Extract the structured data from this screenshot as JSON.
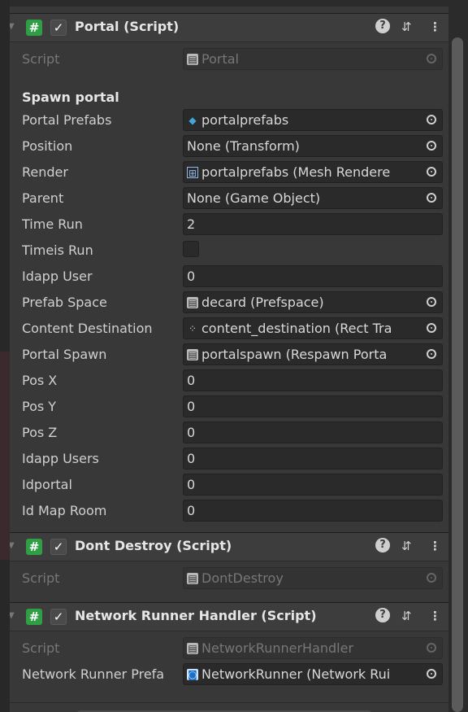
{
  "components": [
    {
      "title": "Portal (Script)",
      "script_label": "Script",
      "script_value": "Portal",
      "section_header": "Spawn portal",
      "fields": [
        {
          "label": "Portal Prefabs",
          "value": "portalprefabs",
          "icon": "prefab-icon",
          "picker": true
        },
        {
          "label": "Position",
          "value": "None (Transform)",
          "icon": "",
          "picker": true
        },
        {
          "label": "Render",
          "value": "portalprefabs (Mesh Rendere",
          "icon": "mesh-renderer-icon",
          "picker": true
        },
        {
          "label": "Parent",
          "value": "None (Game Object)",
          "icon": "",
          "picker": true
        },
        {
          "label": "Time Run",
          "value": "2",
          "icon": "",
          "picker": false
        },
        {
          "label": "Timeis Run",
          "value": "",
          "type": "toggle",
          "checked": false
        },
        {
          "label": "Idapp User",
          "value": "0",
          "icon": "",
          "picker": false
        },
        {
          "label": "Prefab Space",
          "value": "decard (Prefspace)",
          "icon": "script-icon",
          "picker": true
        },
        {
          "label": "Content Destination",
          "value": "content_destination (Rect Tra",
          "icon": "rect-transform-icon",
          "picker": true
        },
        {
          "label": "Portal Spawn",
          "value": "portalspawn (Respawn Porta",
          "icon": "script-icon",
          "picker": true
        },
        {
          "label": "Pos X",
          "value": "0",
          "icon": "",
          "picker": false
        },
        {
          "label": "Pos Y",
          "value": "0",
          "icon": "",
          "picker": false
        },
        {
          "label": "Pos Z",
          "value": "0",
          "icon": "",
          "picker": false
        },
        {
          "label": "Idapp Users",
          "value": "0",
          "icon": "",
          "picker": false
        },
        {
          "label": "Idportal",
          "value": "0",
          "icon": "",
          "picker": false
        },
        {
          "label": "Id Map Room",
          "value": "0",
          "icon": "",
          "picker": false
        }
      ]
    },
    {
      "title": "Dont Destroy (Script)",
      "script_label": "Script",
      "script_value": "DontDestroy"
    },
    {
      "title": "Network Runner Handler (Script)",
      "script_label": "Script",
      "script_value": "NetworkRunnerHandler",
      "fields": [
        {
          "label": "Network Runner Prefa",
          "value": "NetworkRunner (Network Rui",
          "icon": "network-runner-icon",
          "picker": true
        }
      ]
    }
  ],
  "icons": {
    "script": "script-icon",
    "help": "help-icon",
    "presets": "presets-icon",
    "menu": "kebab-menu-icon",
    "check": "checkmark-icon",
    "picker": "object-picker-icon"
  },
  "colors": {
    "panel": "#383838",
    "field": "#2a2a2a",
    "script_icon": "#2f9e45",
    "prefab_icon": "#41a6e0"
  }
}
